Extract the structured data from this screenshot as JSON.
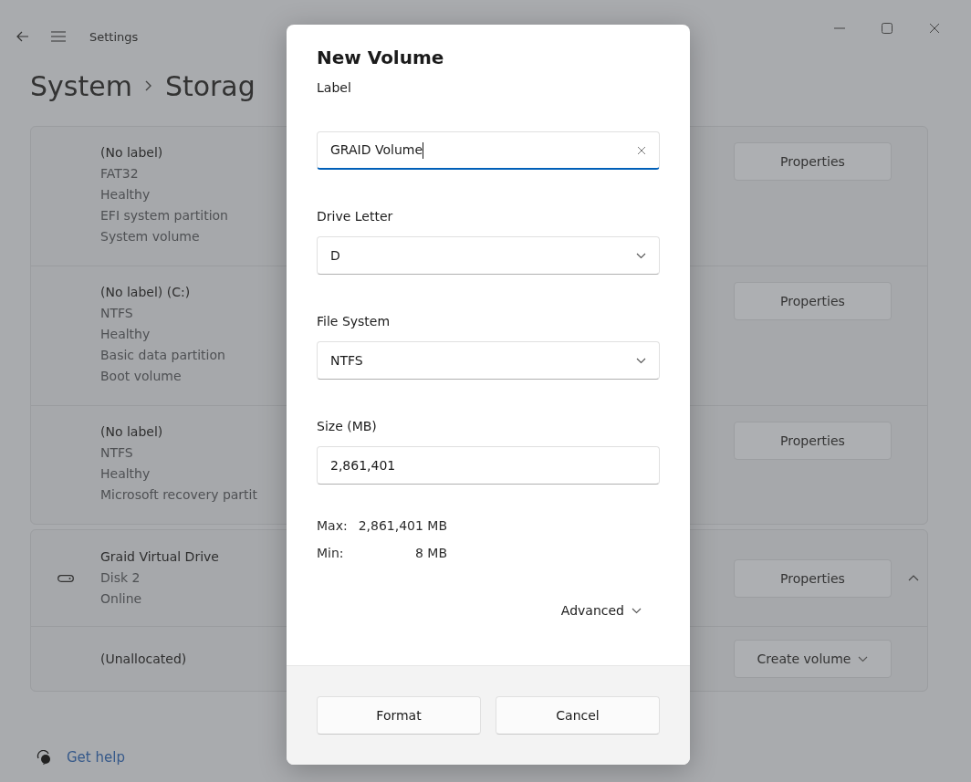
{
  "window": {
    "title": "Settings"
  },
  "breadcrumb": [
    "System",
    "Storag"
  ],
  "partitions": [
    {
      "lines": [
        "(No label)",
        "FAT32",
        "Healthy",
        "EFI system partition",
        "System volume"
      ],
      "button": "Properties"
    },
    {
      "lines": [
        "(No label) (C:)",
        "NTFS",
        "Healthy",
        "Basic data partition",
        "Boot volume"
      ],
      "button": "Properties"
    },
    {
      "lines": [
        "(No label)",
        "NTFS",
        "Healthy",
        "Microsoft recovery partit"
      ],
      "button": "Properties"
    }
  ],
  "drive": {
    "lines": [
      "Graid Virtual Drive",
      "Disk 2",
      "Online"
    ],
    "button": "Properties",
    "expanded": true
  },
  "unallocated": {
    "label": "(Unallocated)",
    "button": "Create volume"
  },
  "help_link": "Get help",
  "dialog": {
    "title": "New Volume",
    "fields": [
      {
        "kind": "text",
        "label": "Label",
        "value": "GRAID Volume",
        "focused": true
      },
      {
        "kind": "dropdown",
        "label": "Drive Letter",
        "value": "D"
      },
      {
        "kind": "dropdown",
        "label": "File System",
        "value": "NTFS"
      },
      {
        "kind": "text",
        "label": "Size (MB)",
        "value": "2,861,401",
        "focused": false
      }
    ],
    "limits": [
      {
        "label": "Max:",
        "value": "2,861,401 MB"
      },
      {
        "label": "Min:",
        "value": "8 MB"
      }
    ],
    "advanced": "Advanced",
    "buttons": [
      "Format",
      "Cancel"
    ]
  }
}
